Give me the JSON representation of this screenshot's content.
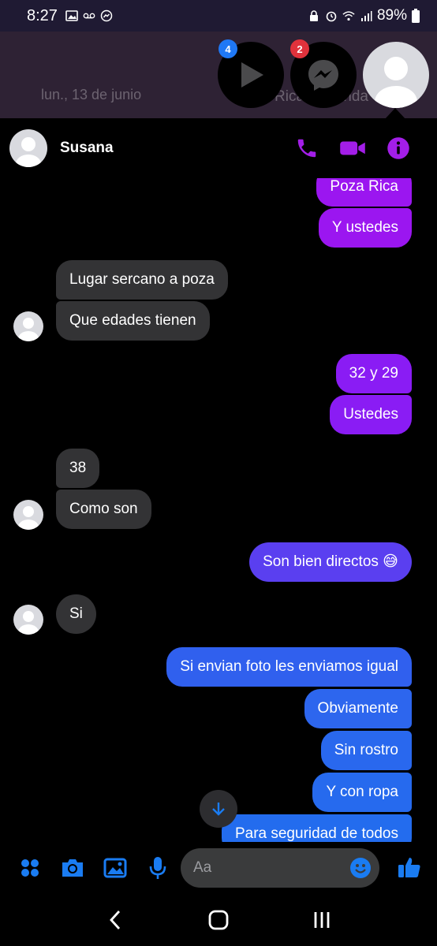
{
  "status_bar": {
    "time": "8:27",
    "battery": "89%"
  },
  "background": {
    "date": "lun., 13 de junio",
    "title_fragment": "Ricardo Andrade"
  },
  "chat_heads": {
    "video_badge": "4",
    "messenger_badge": "2"
  },
  "chat": {
    "contact_name": "Susana"
  },
  "messages": [
    {
      "dir": "out",
      "text": "Poza Rica",
      "color": "#9b16f0"
    },
    {
      "dir": "out",
      "text": "Y ustedes",
      "color": "#9b16f0"
    },
    {
      "dir": "in",
      "text": "Lugar sercano a poza"
    },
    {
      "dir": "in",
      "text": "Que edades tienen"
    },
    {
      "dir": "out",
      "text": "32 y 29",
      "color": "#8a1cf4"
    },
    {
      "dir": "out",
      "text": "Ustedes",
      "color": "#8a1cf4"
    },
    {
      "dir": "in",
      "text": "38"
    },
    {
      "dir": "in",
      "text": "Como son"
    },
    {
      "dir": "out",
      "text": "Son bien directos 😅",
      "color": "#5a3ff0"
    },
    {
      "dir": "in",
      "text": "Si"
    },
    {
      "dir": "out",
      "text": "Si envian foto les enviamos igual",
      "color": "#3060ee"
    },
    {
      "dir": "out",
      "text": "Obviamente",
      "color": "#2d66ee"
    },
    {
      "dir": "out",
      "text": "Sin rostro",
      "color": "#2968ee"
    },
    {
      "dir": "out",
      "text": "Y con ropa",
      "color": "#266aee"
    },
    {
      "dir": "out",
      "text": "Para seguridad de todos",
      "color": "#236cee"
    }
  ],
  "composer": {
    "placeholder": "Aa"
  },
  "colors": {
    "accent_purple": "#a31ee8",
    "accent_blue": "#1a7cf2",
    "incoming_bubble": "#333335"
  }
}
